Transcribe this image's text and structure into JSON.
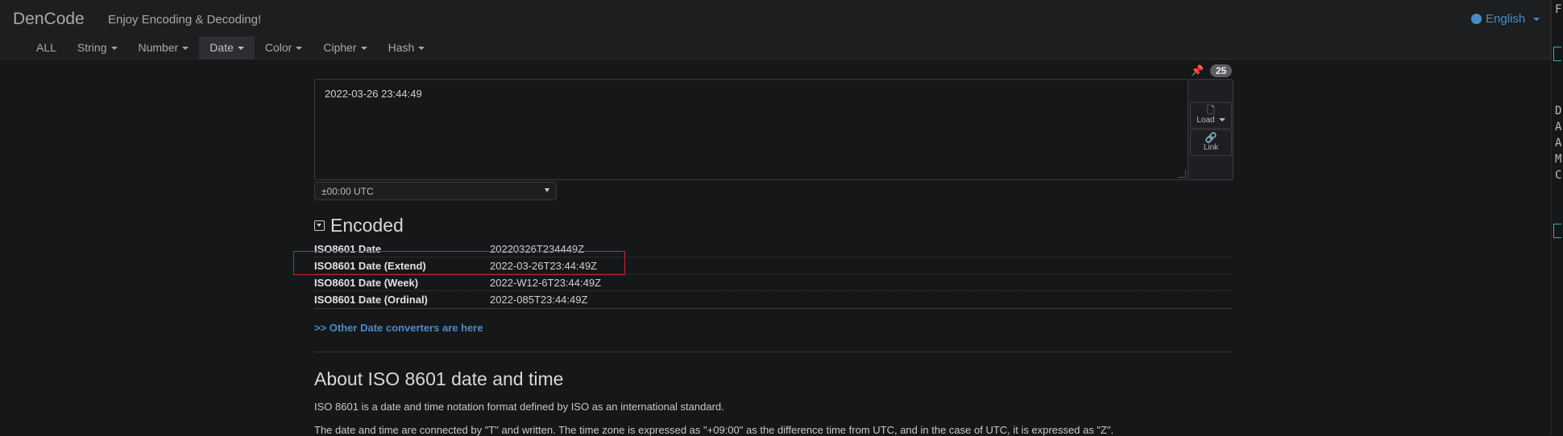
{
  "header": {
    "brand": "DenCode",
    "tagline": "Enjoy Encoding & Decoding!",
    "language": "English",
    "menu": [
      "ALL",
      "String",
      "Number",
      "Date",
      "Color",
      "Cipher",
      "Hash"
    ],
    "active_menu": "Date"
  },
  "input": {
    "value": "2022-03-26 23:44:49",
    "char_count": "25",
    "load_label": "Load",
    "link_label": "Link",
    "timezone": "±00:00 UTC"
  },
  "encoded": {
    "title": "Encoded",
    "rows": [
      {
        "label": "ISO8601 Date",
        "value": "20220326T234449Z"
      },
      {
        "label": "ISO8601 Date (Extend)",
        "value": "2022-03-26T23:44:49Z"
      },
      {
        "label": "ISO8601 Date (Week)",
        "value": "2022-W12-6T23:44:49Z"
      },
      {
        "label": "ISO8601 Date (Ordinal)",
        "value": "2022-085T23:44:49Z"
      }
    ],
    "highlighted_row": "ISO8601 Date (Extend)"
  },
  "other_link": ">> Other Date converters are here",
  "about": {
    "title": "About ISO 8601 date and time",
    "p1": "ISO 8601 is a date and time notation format defined by ISO as an international standard.",
    "p2": "The date and time are connected by \"T\" and written. The time zone is expressed as \"+09:00\" as the difference time from UTC, and in the case of UTC, it is expressed as \"Z\"."
  },
  "right_strip": {
    "chars": [
      "F",
      "D",
      "A",
      "A",
      "M",
      "C"
    ]
  },
  "colors": {
    "background": "#161719",
    "navbar": "#1d1e20",
    "link": "#4a8cc9",
    "highlight": "#c62828"
  }
}
